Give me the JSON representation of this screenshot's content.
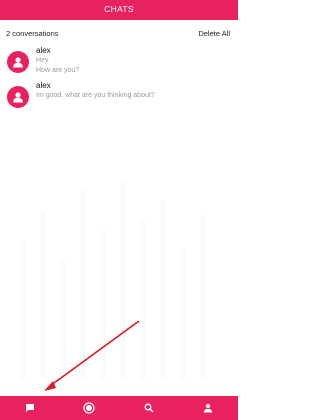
{
  "header": {
    "title": "CHATS"
  },
  "toolbar": {
    "count_label": "2 conversations",
    "delete_all_label": "Delete All"
  },
  "conversations": [
    {
      "name": "alex",
      "messages": [
        "Hey",
        "How are you?"
      ]
    },
    {
      "name": "alex",
      "messages": [
        "Im good. what are you thinking about?"
      ]
    }
  ],
  "bottom_nav": [
    {
      "icon": "chat-icon",
      "active": true
    },
    {
      "icon": "camera-lens-icon",
      "active": false
    },
    {
      "icon": "search-icon",
      "active": false
    },
    {
      "icon": "profile-icon",
      "active": false
    }
  ],
  "colors": {
    "accent": "#e8215f",
    "annotation_arrow": "#d91c2b",
    "secondary_text": "#9a9a9a"
  }
}
